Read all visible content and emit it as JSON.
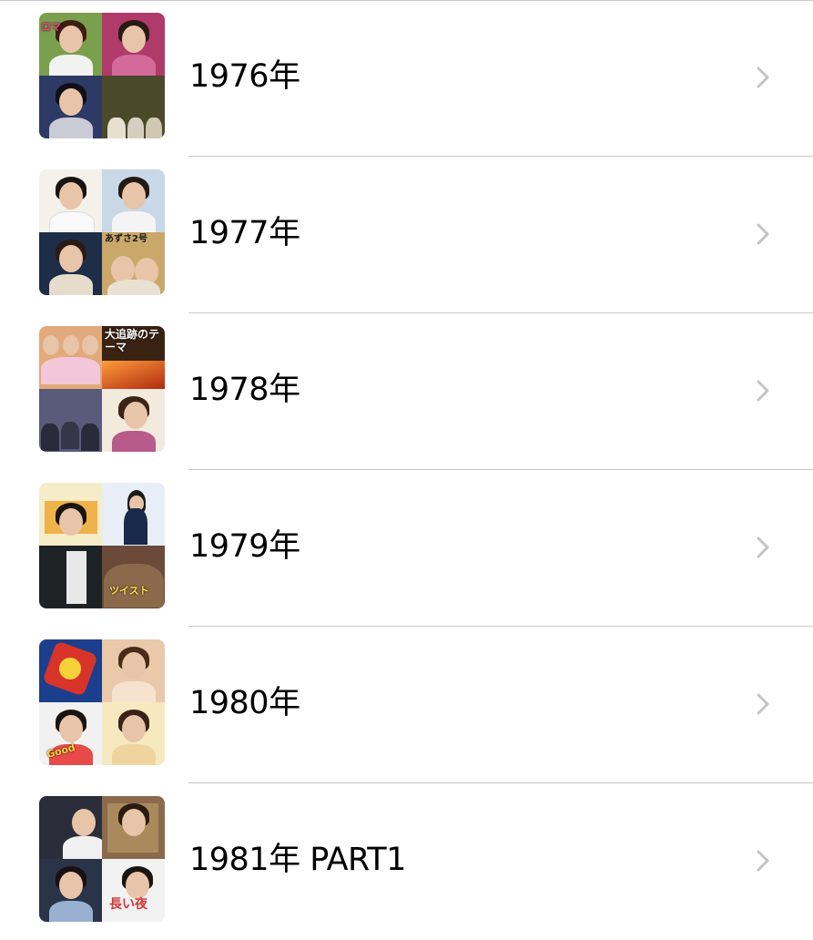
{
  "colors": {
    "separator": "#c8c8cc",
    "chevron": "#c4c4c7",
    "text": "#000000",
    "background": "#ffffff"
  },
  "albums": [
    {
      "label": "1976年",
      "tiles": [
        "#7aa04e",
        "#b03a6a",
        "#2e3a66",
        "#4a4a2a"
      ],
      "texts": [
        "",
        "",
        "",
        ""
      ]
    },
    {
      "label": "1977年",
      "tiles": [
        "#f4f0ea",
        "#c9d8e6",
        "#1f2e48",
        "#caa86a"
      ],
      "texts": [
        "",
        "",
        "",
        "あずさ2号"
      ]
    },
    {
      "label": "1978年",
      "tiles": [
        "#e2a97a",
        "#3a2212",
        "#5a5a7a",
        "#f1eadd"
      ],
      "texts": [
        "",
        "大追跡のテーマ",
        "",
        ""
      ]
    },
    {
      "label": "1979年",
      "tiles": [
        "#f5ecc8",
        "#e7eef6",
        "#1e2224",
        "#6b4a3a"
      ],
      "texts": [
        "",
        "",
        "",
        ""
      ]
    },
    {
      "label": "1980年",
      "tiles": [
        "#1b3f8c",
        "#e9c9a9",
        "#f1f1f1",
        "#f6e9bf"
      ],
      "texts": [
        "",
        "",
        "",
        ""
      ]
    },
    {
      "label": "1981年 PART1",
      "tiles": [
        "#2b2e3a",
        "#8a6a4a",
        "#2a3448",
        "#f2f2f2"
      ],
      "texts": [
        "",
        "",
        "",
        "長い夜"
      ]
    }
  ],
  "chevron_icon": "chevron-right-icon"
}
